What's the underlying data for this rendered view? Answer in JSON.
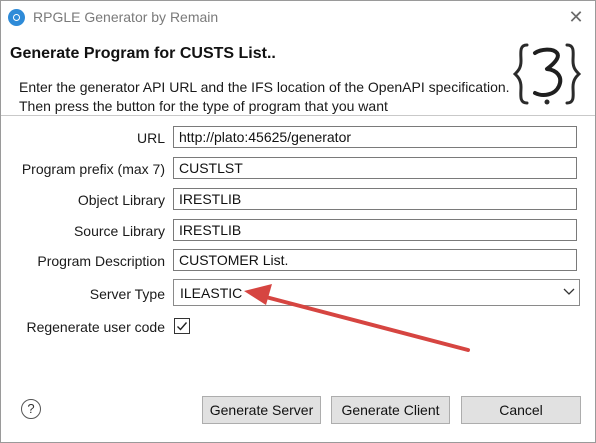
{
  "window": {
    "title": "RPGLE Generator by Remain",
    "close_glyph": "✕"
  },
  "header": {
    "heading": "Generate Program for CUSTS List..",
    "description": "Enter the generator API URL and the IFS location of the OpenAPI specification. Then press the button for the type of program that you want",
    "logo_icon": "curly-brace-3-logo-icon"
  },
  "form": {
    "url_label": "URL",
    "url_value": "http://plato:45625/generator",
    "prefix_label": "Program prefix (max 7)",
    "prefix_value": "CUSTLST",
    "object_library_label": "Object Library",
    "object_library_value": "IRESTLIB",
    "source_library_label": "Source Library",
    "source_library_value": "IRESTLIB",
    "description_label": "Program Description",
    "description_value": "CUSTOMER List.",
    "server_type_label": "Server Type",
    "server_type_value": "ILEASTIC",
    "regenerate_label": "Regenerate user code",
    "regenerate_checked": true,
    "checkmark_glyph": "✓"
  },
  "footer": {
    "help_glyph": "?",
    "generate_server_label": "Generate Server",
    "generate_client_label": "Generate Client",
    "cancel_label": "Cancel"
  },
  "colors": {
    "annotation_arrow": "#d64541",
    "app_icon": "#2e8bd8",
    "button_face": "#e1e1e1"
  }
}
